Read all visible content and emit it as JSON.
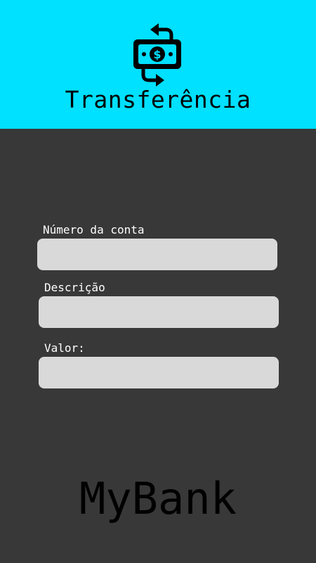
{
  "header": {
    "title": "Transferência",
    "icon": "money-transfer-icon",
    "background": "#00E0FF"
  },
  "form": {
    "account_number": {
      "label": "Número da conta",
      "value": "",
      "placeholder": ""
    },
    "description": {
      "label": "Descrição",
      "value": "",
      "placeholder": ""
    },
    "amount": {
      "label": "Valor:",
      "value": "",
      "placeholder": ""
    }
  },
  "footer": {
    "brand": "MyBank"
  },
  "colors": {
    "background": "#383838",
    "field": "#D9D9D9",
    "accent": "#00E0FF"
  }
}
